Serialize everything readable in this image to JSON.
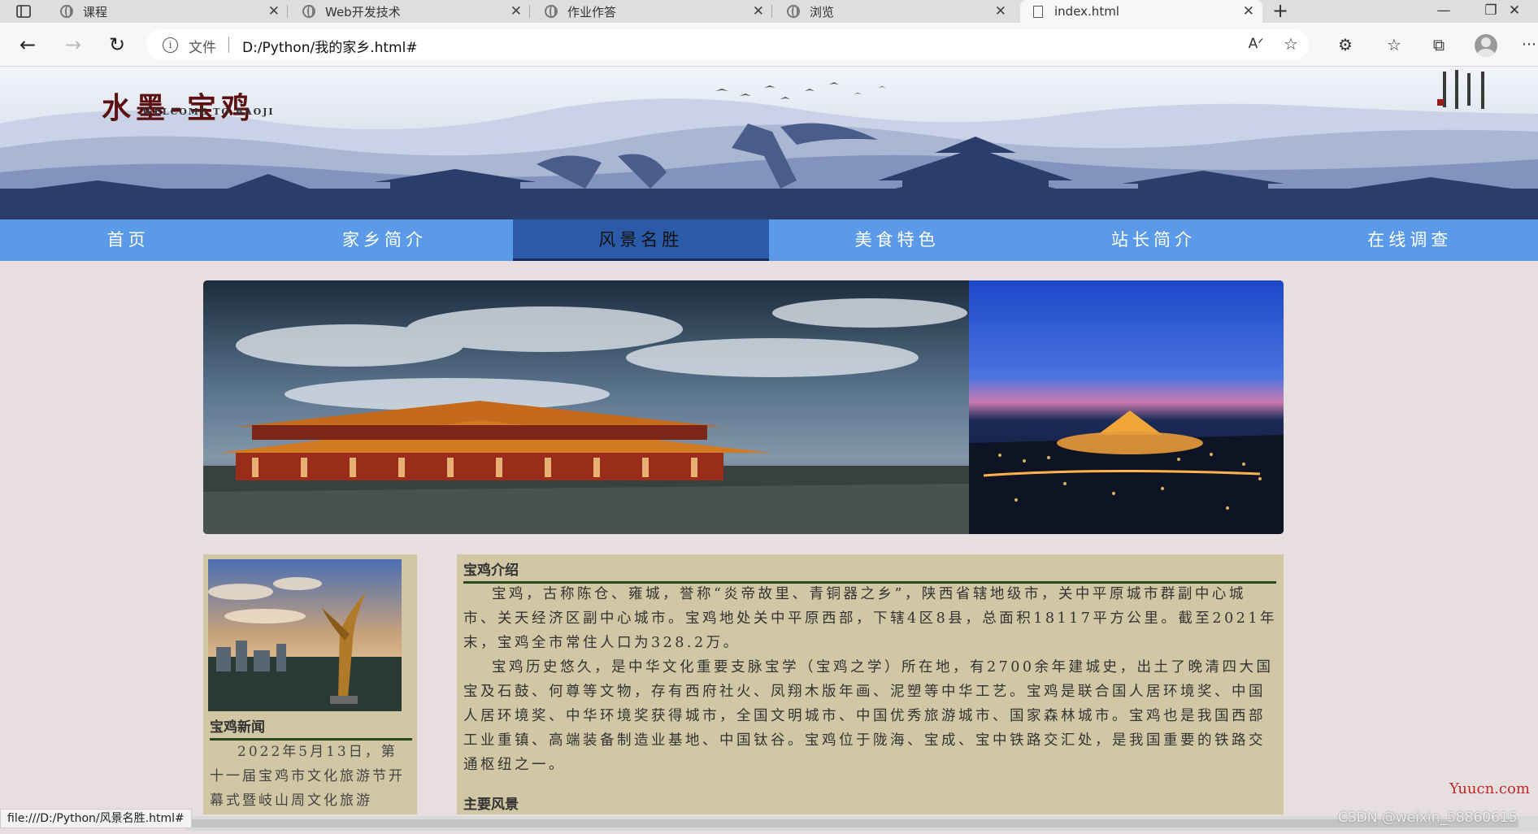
{
  "browser": {
    "tabs": [
      {
        "title": "课程"
      },
      {
        "title": "Web开发技术"
      },
      {
        "title": "作业作答"
      },
      {
        "title": "浏览"
      },
      {
        "title": "index.html"
      }
    ],
    "url_label": "文件",
    "url": "D:/Python/我的家乡.html#",
    "status_url": "file:///D:/Python/风景名胜.html#"
  },
  "banner": {
    "title": "水墨-宝鸡",
    "subtitle": "WELCOME TO BAOJI"
  },
  "nav": {
    "items": [
      {
        "label": "首页"
      },
      {
        "label": "家乡简介"
      },
      {
        "label": "风景名胜",
        "active": true
      },
      {
        "label": "美食特色"
      },
      {
        "label": "站长简介"
      },
      {
        "label": "在线调查"
      }
    ]
  },
  "sidebar": {
    "title": "宝鸡新闻",
    "text": "2022年5月13日，第十一届宝鸡市文化旅游节开幕式暨岐山周文化旅游"
  },
  "main": {
    "title": "宝鸡介绍",
    "paragraph1": "宝鸡，古称陈仓、雍城，誉称“炎帝故里、青铜器之乡”，陕西省辖地级市，关中平原城市群副中心城市、关天经济区副中心城市。宝鸡地处关中平原西部，下辖4区8县，总面积18117平方公里。截至2021年末，宝鸡全市常住人口为328.2万。",
    "paragraph2": "宝鸡历史悠久，是中华文化重要支脉宝学（宝鸡之学）所在地，有2700余年建城史，出土了晚清四大国宝及石鼓、何尊等文物，存有西府社火、凤翔木版年画、泥塑等中华工艺。宝鸡是联合国人居环境奖、中国人居环境奖、中华环境奖获得城市，全国文明城市、中国优秀旅游城市、国家森林城市。宝鸡也是我国西部工业重镇、高端装备制造业基地、中国钛谷。宝鸡位于陇海、宝成、宝中铁路交汇处，是我国重要的铁路交通枢纽之一。",
    "section2_title": "主要风景"
  },
  "watermarks": {
    "yuucn": "Yuucn.com",
    "csdn": "CSDN @weixin_58860615"
  },
  "colors": {
    "nav_bg": "#5b9ae9",
    "nav_active": "#2b5aa8",
    "panel_bg": "#d1c7a4",
    "page_bg": "#e7dfdf",
    "rule": "#2a4a18"
  }
}
